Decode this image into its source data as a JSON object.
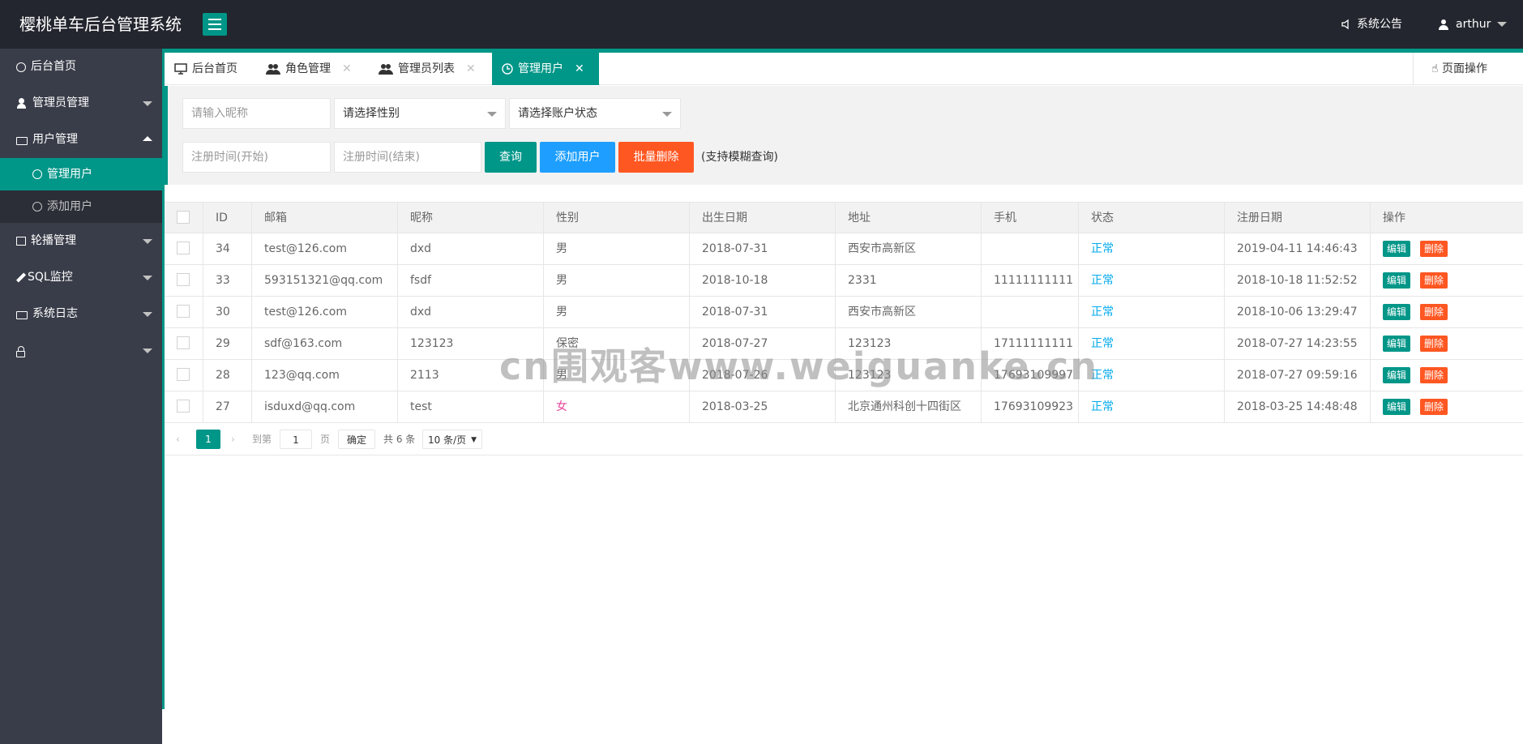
{
  "header": {
    "logo": "樱桃单车后台管理系统",
    "notice": "系统公告",
    "username": "arthur"
  },
  "sidebar": {
    "items": [
      {
        "label": "后台首页",
        "icon": "refresh-icon"
      },
      {
        "label": "管理员管理",
        "icon": "person-icon"
      },
      {
        "label": "用户管理",
        "icon": "folder-icon"
      },
      {
        "label": "轮播管理",
        "icon": "grid-icon"
      },
      {
        "label": "SQL监控",
        "icon": "pencil-icon"
      },
      {
        "label": "系统日志",
        "icon": "folder-icon"
      },
      {
        "label": "",
        "icon": "lock-icon"
      }
    ],
    "sub_items": [
      {
        "label": "管理用户",
        "active": true
      },
      {
        "label": "添加用户",
        "active": false
      }
    ]
  },
  "tabs": [
    {
      "label": "后台首页",
      "icon": "monitor-icon"
    },
    {
      "label": "角色管理",
      "icon": "users-icon"
    },
    {
      "label": "管理员列表",
      "icon": "users-icon"
    },
    {
      "label": "管理用户",
      "icon": "clock-icon",
      "active": true
    }
  ],
  "page_ops": "页面操作",
  "search": {
    "nickname_placeholder": "请输入昵称",
    "gender_select": "请选择性别",
    "status_select": "请选择账户状态",
    "start_placeholder": "注册时间(开始)",
    "end_placeholder": "注册时间(结束)",
    "query_btn": "查询",
    "add_btn": "添加用户",
    "batch_delete_btn": "批量删除",
    "tip": "(支持模糊查询)"
  },
  "table": {
    "headers": [
      "ID",
      "邮箱",
      "昵称",
      "性别",
      "出生日期",
      "地址",
      "手机",
      "状态",
      "注册日期",
      "操作"
    ],
    "edit_label": "编辑",
    "delete_label": "删除",
    "rows": [
      {
        "id": "34",
        "email": "test@126.com",
        "nickname": "dxd",
        "gender": "男",
        "birth": "2018-07-31",
        "address": "西安市高新区",
        "phone": "",
        "status": "正常",
        "reg": "2019-04-11 14:46:43"
      },
      {
        "id": "33",
        "email": "593151321@qq.com",
        "nickname": "fsdf",
        "gender": "男",
        "birth": "2018-10-18",
        "address": "2331",
        "phone": "11111111111",
        "status": "正常",
        "reg": "2018-10-18 11:52:52"
      },
      {
        "id": "30",
        "email": "test@126.com",
        "nickname": "dxd",
        "gender": "男",
        "birth": "2018-07-31",
        "address": "西安市高新区",
        "phone": "",
        "status": "正常",
        "reg": "2018-10-06 13:29:47"
      },
      {
        "id": "29",
        "email": "sdf@163.com",
        "nickname": "123123",
        "gender": "保密",
        "birth": "2018-07-27",
        "address": "123123",
        "phone": "17111111111",
        "status": "正常",
        "reg": "2018-07-27 14:23:55"
      },
      {
        "id": "28",
        "email": "123@qq.com",
        "nickname": "2113",
        "gender": "男",
        "birth": "2018-07-26",
        "address": "123123",
        "phone": "17693109997",
        "status": "正常",
        "reg": "2018-07-27 09:59:16"
      },
      {
        "id": "27",
        "email": "isduxd@qq.com",
        "nickname": "test",
        "gender": "女",
        "birth": "2018-03-25",
        "address": "北京通州科创十四街区",
        "phone": "17693109923",
        "status": "正常",
        "reg": "2018-03-25 14:48:48"
      }
    ]
  },
  "pager": {
    "current": "1",
    "goto_label": "到第",
    "page_input": "1",
    "page_label": "页",
    "confirm": "确定",
    "total": "共 6 条",
    "per_page": "10 条/页"
  },
  "watermark": "cn围观客www.weiguanke.cn",
  "colors": {
    "header_bg": "#23262e",
    "sidebar_bg": "#393d49",
    "accent": "#009688",
    "add_btn": "#1e9fff",
    "delete_btn": "#ff5722",
    "status": "#01aaed"
  }
}
